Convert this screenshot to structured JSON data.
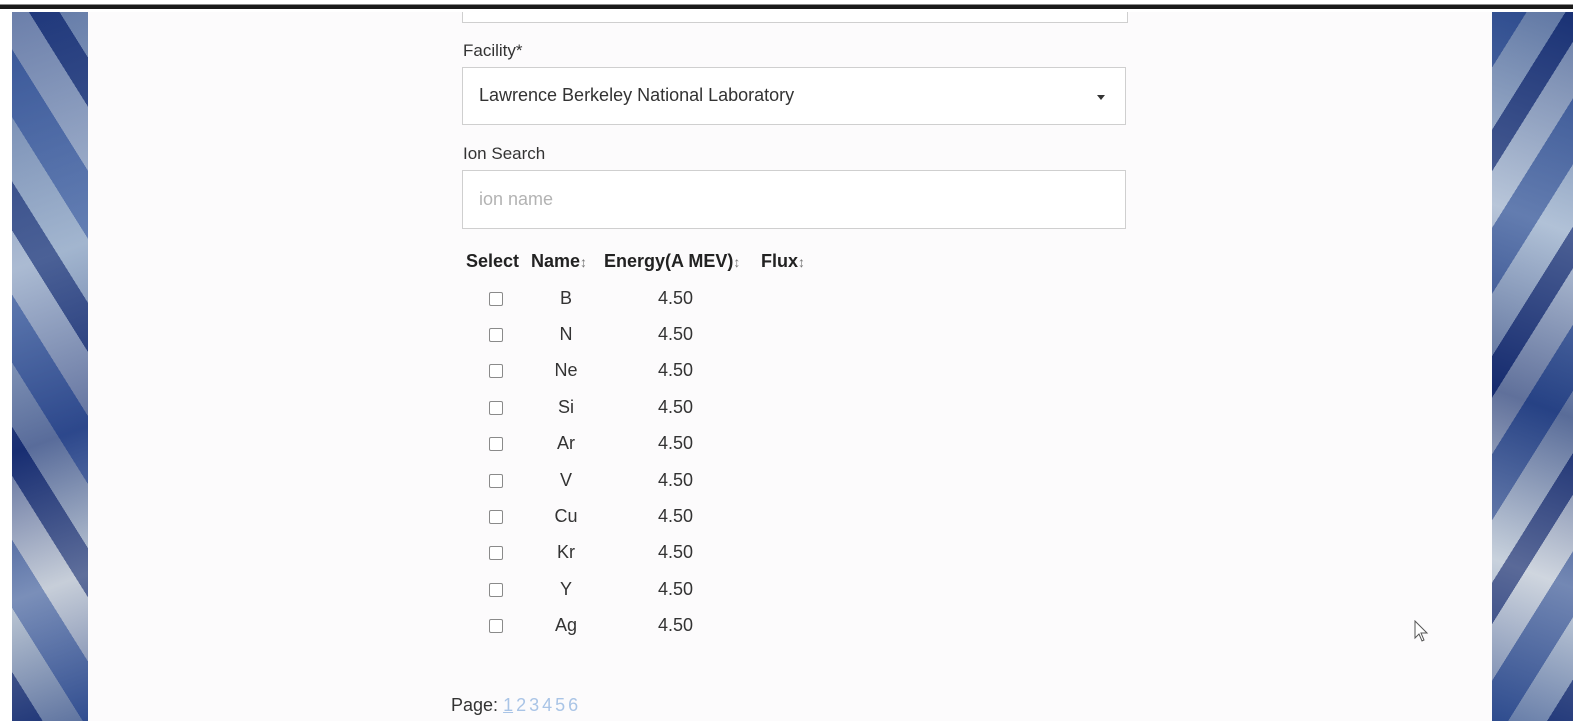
{
  "form": {
    "facility_label": "Facility*",
    "facility_value": "Lawrence Berkeley National Laboratory",
    "ion_search_label": "Ion Search",
    "ion_search_placeholder": "ion name",
    "ion_search_value": ""
  },
  "table": {
    "headers": [
      "Select",
      "Name",
      "Energy(A MEV)",
      "Flux"
    ],
    "sort_icon": "↕",
    "rows": [
      {
        "name": "B",
        "energy": "4.50",
        "flux": ""
      },
      {
        "name": "N",
        "energy": "4.50",
        "flux": ""
      },
      {
        "name": "Ne",
        "energy": "4.50",
        "flux": ""
      },
      {
        "name": "Si",
        "energy": "4.50",
        "flux": ""
      },
      {
        "name": "Ar",
        "energy": "4.50",
        "flux": ""
      },
      {
        "name": "V",
        "energy": "4.50",
        "flux": ""
      },
      {
        "name": "Cu",
        "energy": "4.50",
        "flux": ""
      },
      {
        "name": "Kr",
        "energy": "4.50",
        "flux": ""
      },
      {
        "name": "Y",
        "energy": "4.50",
        "flux": ""
      },
      {
        "name": "Ag",
        "energy": "4.50",
        "flux": ""
      }
    ]
  },
  "pagination": {
    "label": "Page:",
    "pages": [
      "1",
      "2",
      "3",
      "4",
      "5",
      "6"
    ],
    "current": "1"
  },
  "icons": {
    "dropdown": "caret-down-icon",
    "sort": "sort-icon",
    "cursor": "mouse-pointer-icon"
  },
  "colors": {
    "link": "#a9c4e6",
    "border": "#cfcfcf"
  }
}
